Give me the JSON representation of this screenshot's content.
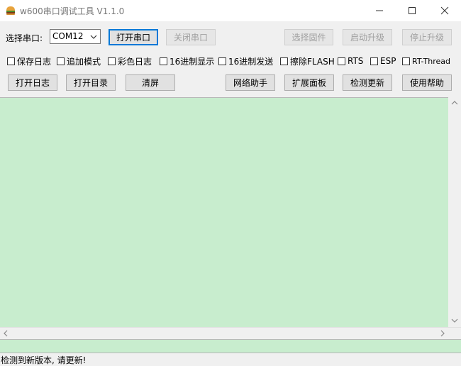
{
  "window": {
    "title": "w600串口调试工具 V1.1.0",
    "icon": "hamburger-icon"
  },
  "port": {
    "label": "选择串口:",
    "selected": "COM12",
    "open_button": "打开串口",
    "close_button": "关闭串口"
  },
  "firmware": {
    "select_button": "选择固件",
    "start_button": "启动升级",
    "stop_button": "停止升级"
  },
  "options": {
    "save_log": "保存日志",
    "append_mode": "追加模式",
    "color_log": "彩色日志",
    "hex_display": "16进制显示",
    "hex_send": "16进制发送",
    "erase_flash": "擦除FLASH",
    "rts": "RTS",
    "esp": "ESP",
    "rt_thread": "RT-Thread"
  },
  "actions": {
    "open_log": "打开日志",
    "open_dir": "打开目录",
    "clear": "清屏",
    "net_helper": "网络助手",
    "ext_panel": "扩展面板",
    "check_update": "检测更新",
    "help": "使用帮助"
  },
  "status": {
    "message": "检测到新版本, 请更新!"
  },
  "colors": {
    "log_bg": "#c8edce",
    "window_bg": "#f0f0f0",
    "focus_border": "#0078d7"
  }
}
